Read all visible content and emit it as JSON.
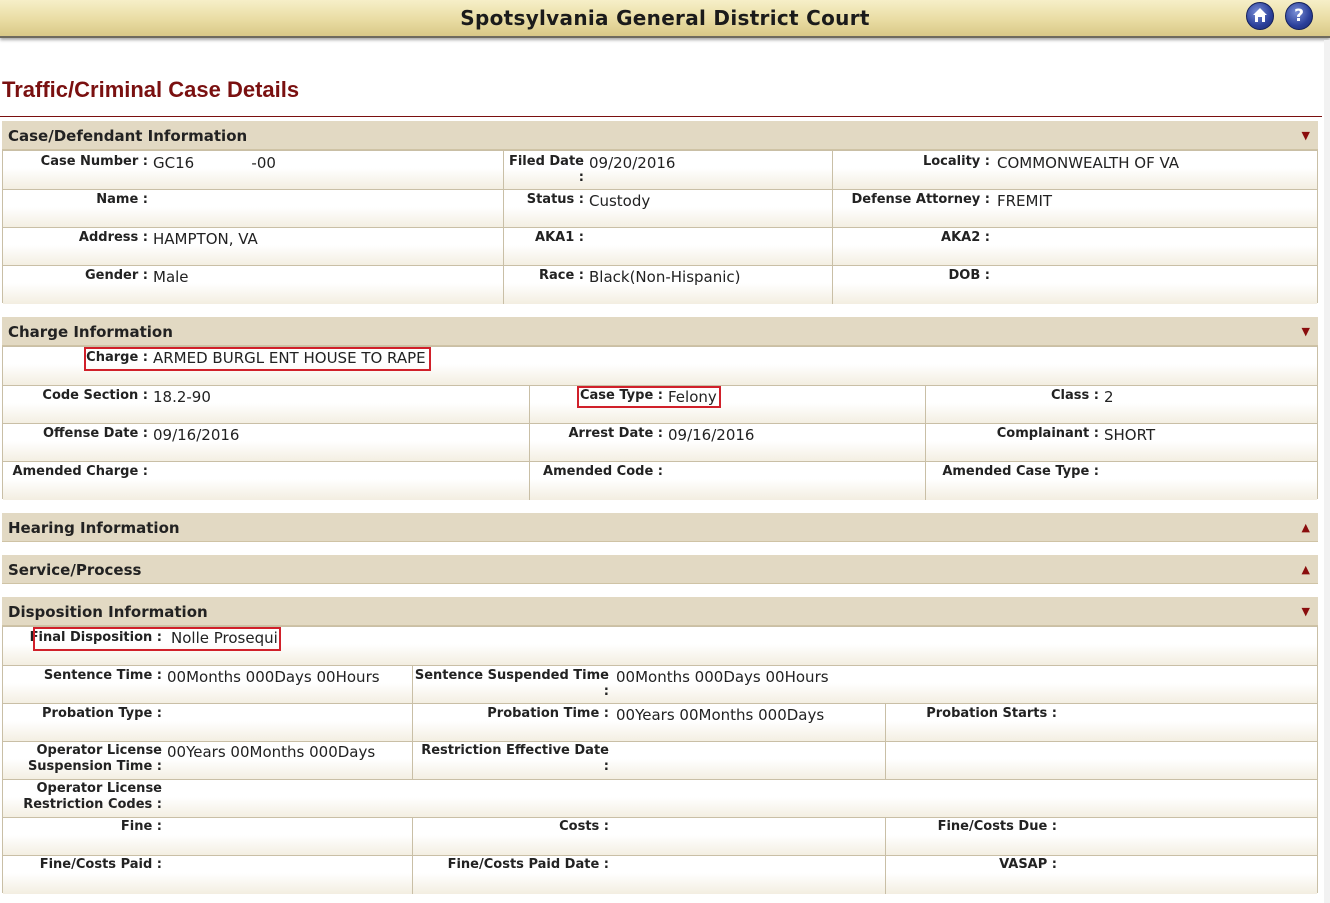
{
  "app": {
    "court_name": "Spotsylvania General District Court",
    "page_title": "Traffic/Criminal Case Details"
  },
  "icons": {
    "home": "home-icon",
    "help": "help-icon",
    "help_glyph": "?"
  },
  "colors": {
    "title": "#7a1010",
    "highlight": "#d0202a",
    "header_bg": "#e2d9c3"
  },
  "sections": {
    "case": {
      "title": "Case/Defendant Information",
      "arrow": "▼"
    },
    "charge": {
      "title": "Charge Information",
      "arrow": "▼"
    },
    "hearing": {
      "title": "Hearing Information",
      "arrow": "▲"
    },
    "service": {
      "title": "Service/Process",
      "arrow": "▲"
    },
    "disposition": {
      "title": "Disposition Information",
      "arrow": "▼"
    }
  },
  "case": {
    "case_number_label": "Case Number :",
    "case_number": "GC16            -00",
    "filed_date_label": "Filed Date :",
    "filed_date": "09/20/2016",
    "locality_label": "Locality :",
    "locality": "COMMONWEALTH OF VA",
    "name_label": "Name :",
    "name": "",
    "status_label": "Status :",
    "status": "Custody",
    "defense_label": "Defense Attorney :",
    "defense": "FREMIT",
    "address_label": "Address :",
    "address": "HAMPTON, VA",
    "aka1_label": "AKA1 :",
    "aka1": "",
    "aka2_label": "AKA2 :",
    "aka2": "",
    "gender_label": "Gender :",
    "gender": "Male",
    "race_label": "Race :",
    "race": "Black(Non-Hispanic)",
    "dob_label": "DOB :",
    "dob": ""
  },
  "charge": {
    "charge_label": "Charge :",
    "charge": "ARMED BURGL ENT HOUSE TO RAPE",
    "code_label": "Code Section :",
    "code": "18.2-90",
    "casetype_label": "Case Type :",
    "casetype": "Felony",
    "class_label": "Class :",
    "class": "2",
    "offense_label": "Offense Date :",
    "offense": "09/16/2016",
    "arrest_label": "Arrest Date :",
    "arrest": "09/16/2016",
    "complainant_label": "Complainant :",
    "complainant": "SHORT",
    "amended_charge_label": "Amended Charge :",
    "amended_code_label": "Amended Code :",
    "amended_type_label": "Amended Case Type :"
  },
  "disposition": {
    "final_label": "Final Disposition :",
    "final": "Nolle Prosequi",
    "sentence_label": "Sentence Time :",
    "sentence": "00Months 000Days 00Hours",
    "suspended_label": "Sentence Suspended Time :",
    "suspended": "00Months 000Days 00Hours",
    "probation_type_label": "Probation Type :",
    "probation_time_label": "Probation Time :",
    "probation_time": "00Years 00Months 000Days",
    "probation_starts_label": "Probation Starts :",
    "op_susp_label_1": "Operator License",
    "op_susp_label_2": "Suspension Time :",
    "op_susp": "00Years 00Months 000Days",
    "restriction_date_label": "Restriction Effective Date :",
    "op_restr_label_1": "Operator License",
    "op_restr_label_2": "Restriction Codes :",
    "fine_label": "Fine :",
    "costs_label": "Costs :",
    "fine_due_label": "Fine/Costs Due :",
    "fine_paid_label": "Fine/Costs Paid :",
    "fine_paid_date_label": "Fine/Costs Paid Date :",
    "vasap_label": "VASAP :"
  }
}
